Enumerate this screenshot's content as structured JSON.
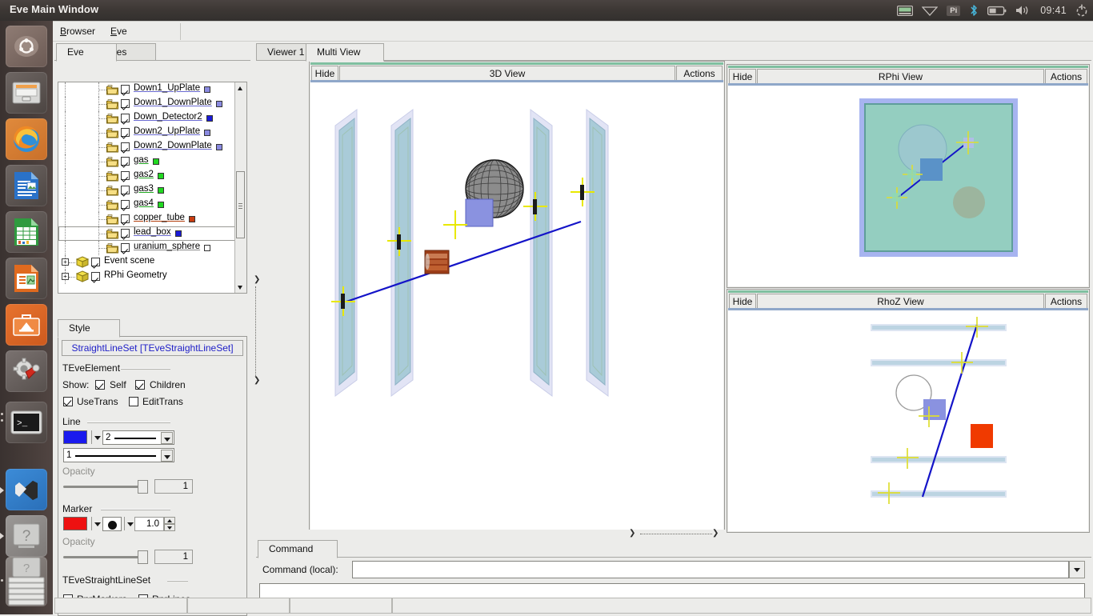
{
  "desktop": {
    "tray": {
      "keyboard_icon": "keyboard-icon",
      "wifi_icon": "wifi-icon",
      "pi_label": "Pi",
      "bluetooth_icon": "bluetooth-icon",
      "battery_icon": "battery-icon",
      "volume_icon": "volume-icon",
      "clock": "09:41",
      "power_icon": "power-icon"
    },
    "launcher": [
      {
        "name": "ubuntu-dash-icon",
        "label": "Ubuntu Dash"
      },
      {
        "name": "files-icon",
        "label": "Files"
      },
      {
        "name": "firefox-icon",
        "label": "Firefox"
      },
      {
        "name": "libreoffice-writer-icon",
        "label": "LibreOffice Writer"
      },
      {
        "name": "libreoffice-calc-icon",
        "label": "LibreOffice Calc"
      },
      {
        "name": "libreoffice-impress-icon",
        "label": "LibreOffice Impress"
      },
      {
        "name": "ubuntu-software-icon",
        "label": "Ubuntu Software"
      },
      {
        "name": "system-settings-icon",
        "label": "System Settings"
      },
      {
        "name": "terminal-icon",
        "label": "Terminal"
      },
      {
        "name": "vscode-icon",
        "label": "Visual Studio Code"
      },
      {
        "name": "help-icon",
        "label": "Help"
      },
      {
        "name": "workspace-switcher-icon",
        "label": "Workspace Switcher"
      }
    ]
  },
  "window": {
    "title": "Eve Main Window"
  },
  "menubar": {
    "items": [
      {
        "mnemonic": "B",
        "rest": "rowser"
      },
      {
        "mnemonic": "E",
        "rest": "ve"
      }
    ]
  },
  "left_panel": {
    "tabs": [
      {
        "label": "Eve",
        "active": true
      },
      {
        "label": "Files",
        "active": false
      }
    ],
    "tree": {
      "items": [
        {
          "label": "Down1_UpPlate",
          "type": "leaf",
          "checked": true,
          "swatch": "#8a8ae0",
          "swatch_fill": true,
          "underline": "#6a6ad0",
          "selected": false
        },
        {
          "label": "Down1_DownPlate",
          "type": "leaf",
          "checked": true,
          "swatch": "#8a8ae0",
          "swatch_fill": true,
          "underline": "#6a6ad0",
          "selected": false
        },
        {
          "label": "Down_Detector2",
          "type": "leaf",
          "checked": true,
          "swatch": "#1a1ad8",
          "swatch_fill": true,
          "underline": "#6a6ad0",
          "selected": false
        },
        {
          "label": "Down2_UpPlate",
          "type": "leaf",
          "checked": true,
          "swatch": "#8a8ae0",
          "swatch_fill": true,
          "underline": "#6a6ad0",
          "selected": false
        },
        {
          "label": "Down2_DownPlate",
          "type": "leaf",
          "checked": true,
          "swatch": "#8a8ae0",
          "swatch_fill": true,
          "underline": "#6a6ad0",
          "selected": false
        },
        {
          "label": "gas",
          "type": "leaf",
          "checked": true,
          "swatch": "#21d821",
          "swatch_fill": true,
          "underline": "#21a821",
          "selected": false
        },
        {
          "label": "gas2",
          "type": "leaf",
          "checked": true,
          "swatch": "#21d821",
          "swatch_fill": true,
          "underline": "#21a821",
          "selected": false
        },
        {
          "label": "gas3",
          "type": "leaf",
          "checked": true,
          "swatch": "#21d821",
          "swatch_fill": true,
          "underline": "#21a821",
          "selected": false
        },
        {
          "label": "gas4",
          "type": "leaf",
          "checked": true,
          "swatch": "#21d821",
          "swatch_fill": true,
          "underline": "#21a821",
          "selected": false
        },
        {
          "label": "copper_tube",
          "type": "leaf",
          "checked": true,
          "swatch": "#c83c10",
          "swatch_fill": true,
          "underline": "#b4400f",
          "selected": false
        },
        {
          "label": "lead_box",
          "type": "leaf",
          "checked": true,
          "swatch": "#1a1ad8",
          "swatch_fill": true,
          "underline": "#6a6ad0",
          "selected": true
        },
        {
          "label": "uranium_sphere",
          "type": "leaf",
          "checked": true,
          "swatch": "#ffffff",
          "swatch_fill": false,
          "underline": "#8a8a8a",
          "selected": false
        },
        {
          "label": "Event scene",
          "type": "branch",
          "checked": true,
          "expander": "+",
          "selected": false
        },
        {
          "label": "RPhi Geometry",
          "type": "branch",
          "checked": true,
          "expander": "+",
          "selected": false
        }
      ]
    },
    "style": {
      "tabs": [
        {
          "label": "Style",
          "active": true
        }
      ],
      "object_button": "StraightLineSet [TEveStraightLineSet]",
      "groups": {
        "element": {
          "title": "TEveElement",
          "show_label": "Show:",
          "self_label": "Self",
          "self_checked": true,
          "children_label": "Children",
          "children_checked": true,
          "usetrans_label": "UseTrans",
          "usetrans_checked": true,
          "edittrans_label": "EditTrans",
          "edittrans_checked": false
        },
        "line": {
          "title": "Line",
          "color": "#1a1aee",
          "width_value": "2",
          "style_value": "1",
          "opacity_label": "Opacity",
          "opacity_value": "1"
        },
        "marker": {
          "title": "Marker",
          "color": "#ee1111",
          "shape": "filled-circle",
          "size_value": "1.0",
          "opacity_label": "Opacity",
          "opacity_value": "1"
        },
        "lineset": {
          "title": "TEveStraightLineSet",
          "rnrmarkers_label": "RnrMarkers",
          "rnrmarkers_checked": true,
          "rnrlines_label": "RnrLines",
          "rnrlines_checked": true
        }
      }
    }
  },
  "views": {
    "tabs": [
      {
        "label": "Viewer 1",
        "active": false
      },
      {
        "label": "Multi View",
        "active": true
      }
    ],
    "panels": [
      {
        "id": "view3d",
        "hide_label": "Hide",
        "title": "3D View",
        "actions_label": "Actions"
      },
      {
        "id": "rphi",
        "hide_label": "Hide",
        "title": "RPhi View",
        "actions_label": "Actions"
      },
      {
        "id": "rhoz",
        "hide_label": "Hide",
        "title": "RhoZ View",
        "actions_label": "Actions"
      }
    ]
  },
  "command": {
    "tabs": [
      {
        "label": "Command",
        "active": true
      }
    ],
    "label": "Command (local):",
    "value": "",
    "output": ""
  },
  "statusbar": {
    "cells": [
      "",
      "",
      "",
      ""
    ]
  }
}
